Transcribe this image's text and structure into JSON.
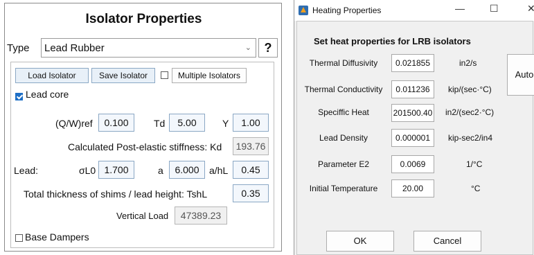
{
  "isolator": {
    "title": "Isolator Properties",
    "type_label": "Type",
    "type_value": "Lead Rubber",
    "help_label": "?",
    "load_button": "Load Isolator",
    "save_button": "Save Isolator",
    "multiple_isolators": {
      "label": "Multiple Isolators",
      "checked": false
    },
    "lead_core": {
      "label": "Lead core",
      "checked": true
    },
    "qw_ref": {
      "label": "(Q/W)ref",
      "value": "0.100"
    },
    "td": {
      "label": "Td",
      "value": "5.00"
    },
    "y": {
      "label": "Y",
      "value": "1.00"
    },
    "kd": {
      "label": "Calculated Post-elastic stiffness: Kd",
      "value": "193.76"
    },
    "lead_label": "Lead:",
    "sigma_l0": {
      "label": "σL0",
      "value": "1.700"
    },
    "a": {
      "label": "a",
      "value": "6.000"
    },
    "a_hl": {
      "label": "a/hL",
      "value": "0.45"
    },
    "tshl": {
      "label": "Total thickness of shims / lead height: TshL",
      "value": "0.35"
    },
    "vertical_load": {
      "label": "Vertical Load",
      "value": "47389.23"
    },
    "base_dampers": {
      "label": "Base Dampers",
      "checked": false
    }
  },
  "heating": {
    "window_title": "Heating Properties",
    "controls": {
      "minimize": "—",
      "maximize": "☐",
      "close": "✕"
    },
    "heading": "Set heat properties for LRB isolators",
    "rows": [
      {
        "label": "Thermal Diffusivity",
        "value": "0.021855",
        "unit": "in2/s"
      },
      {
        "label": "Thermal Conductivity",
        "value": "0.011236",
        "unit": "kip/(sec·°C)"
      },
      {
        "label": "Speciffic Heat",
        "value": "201500.40",
        "unit": "in2/(sec2·°C)"
      },
      {
        "label": "Lead Density",
        "value": "0.000001",
        "unit": "kip-sec2/in4"
      },
      {
        "label": "Parameter E2",
        "value": "0.0069",
        "unit": "1/°C"
      },
      {
        "label": "Initial Temperature",
        "value": "20.00",
        "unit": "°C"
      }
    ],
    "auto_button": "Auto",
    "ok_button": "OK",
    "cancel_button": "Cancel"
  },
  "colors": {
    "accent": "#1e6fc6",
    "field_border": "#8aa7c4"
  }
}
